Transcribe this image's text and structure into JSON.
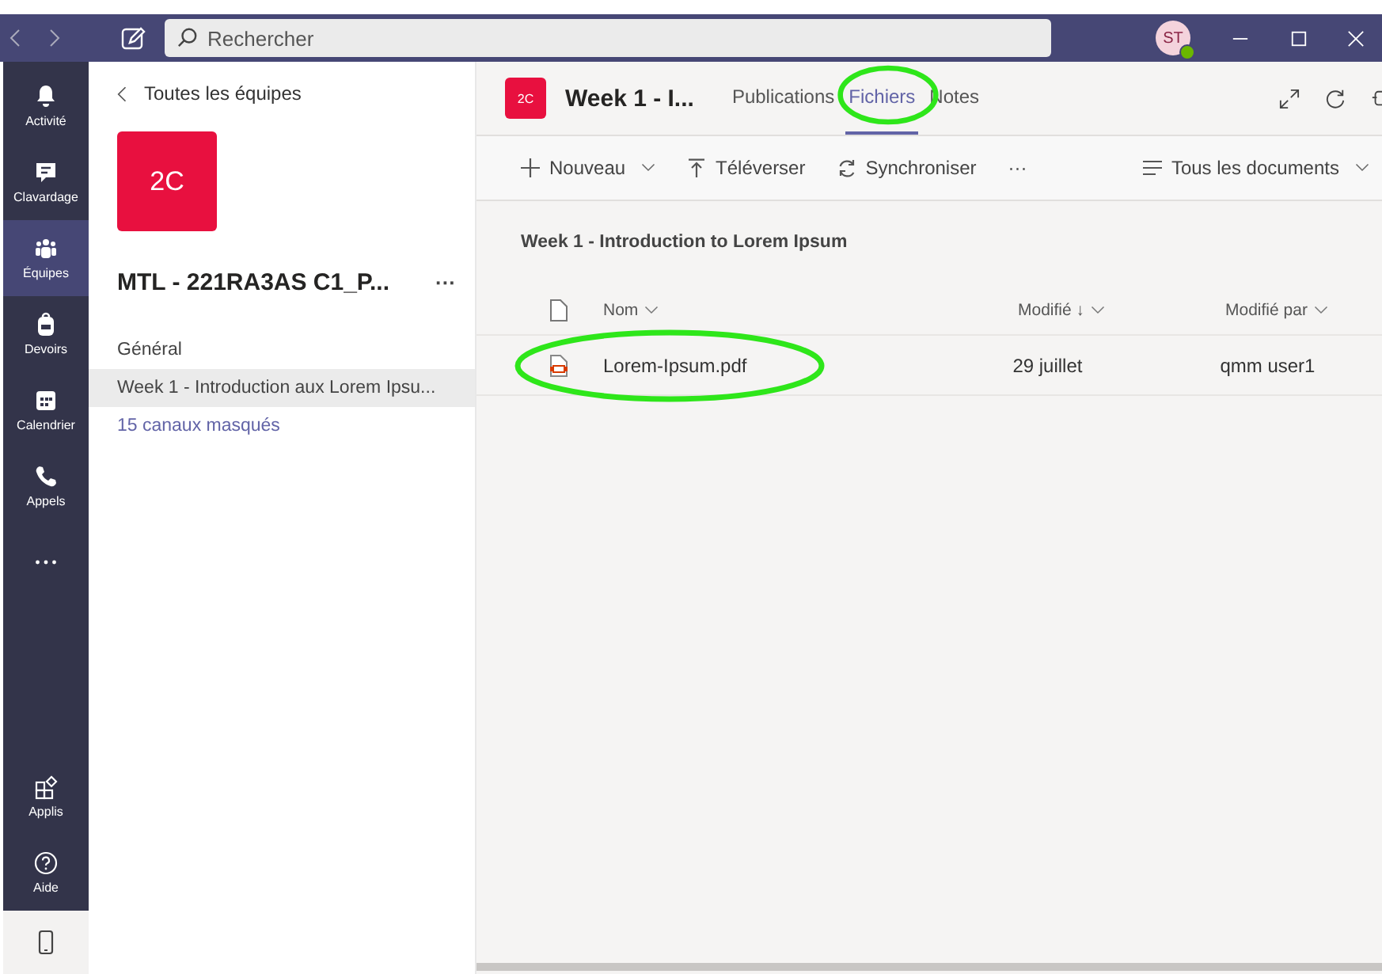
{
  "titlebar": {
    "search": {
      "placeholder": "Rechercher"
    },
    "avatar": {
      "initials": "ST"
    }
  },
  "rail": {
    "items": [
      {
        "kind": "bell",
        "label": "Activité",
        "selected": false
      },
      {
        "kind": "chat",
        "label": "Clavardage",
        "selected": false
      },
      {
        "kind": "teams",
        "label": "Équipes",
        "selected": true
      },
      {
        "kind": "bag",
        "label": "Devoirs",
        "selected": false
      },
      {
        "kind": "calendar",
        "label": "Calendrier",
        "selected": false
      },
      {
        "kind": "phone",
        "label": "Appels",
        "selected": false
      },
      {
        "kind": "more",
        "selected": false
      }
    ],
    "bottom": [
      {
        "kind": "apps",
        "label": "Applis",
        "selected": false
      },
      {
        "kind": "help",
        "label": "Aide",
        "selected": false
      },
      {
        "kind": "mobile",
        "selected": true
      }
    ]
  },
  "channels": {
    "back": "Toutes les équipes",
    "team_tile": "2C",
    "team_name": "MTL - 221RA3AS C1_P...",
    "more": "···",
    "items": [
      {
        "label": "Général",
        "selected": false,
        "kind": "channel"
      },
      {
        "label": "Week 1 - Introduction aux Lorem Ipsu...",
        "selected": true,
        "kind": "channel"
      },
      {
        "label": "15 canaux masqués",
        "selected": false,
        "kind": "link"
      }
    ]
  },
  "header": {
    "tile": "2C",
    "title": "Week 1 - I...",
    "tabs": [
      {
        "label": "Publications",
        "selected": false
      },
      {
        "label": "Fichiers",
        "selected": true
      },
      {
        "label": "Notes",
        "selected": false
      }
    ]
  },
  "toolbar": {
    "items": [
      {
        "kind": "plus",
        "label": "Nouveau",
        "dropdown": true
      },
      {
        "kind": "upload",
        "label": "Téléverser",
        "dropdown": false
      },
      {
        "kind": "sync",
        "label": "Synchroniser",
        "dropdown": false
      },
      {
        "kind": "more",
        "label": "···",
        "dropdown": false
      }
    ],
    "view": "Tous les documents"
  },
  "folder_title": "Week 1 - Introduction to Lorem Ipsum",
  "table": {
    "columns": [
      "Nom",
      "Modifié ↓",
      "Modifié par"
    ],
    "rows": [
      {
        "name": "Lorem-Ipsum.pdf",
        "modified": "29 juillet",
        "modified_by": "qmm user1"
      }
    ]
  }
}
